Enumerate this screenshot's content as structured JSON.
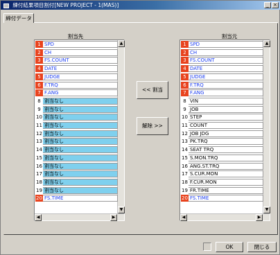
{
  "window": {
    "title": "練付結果項目割付[NEW PROJECT - 1(MAS)]",
    "controls": [
      "_",
      "×"
    ]
  },
  "tab": {
    "label": "締付データ"
  },
  "left_list": {
    "header": "割当先",
    "rows": [
      {
        "num": "1",
        "value": "SPD",
        "style": "blue",
        "num_style": "red"
      },
      {
        "num": "2",
        "value": "CH",
        "style": "blue",
        "num_style": "red"
      },
      {
        "num": "3",
        "value": "FS.COUNT",
        "style": "blue",
        "num_style": "red"
      },
      {
        "num": "4",
        "value": "DATE",
        "style": "blue",
        "num_style": "red"
      },
      {
        "num": "5",
        "value": "JUDGE",
        "style": "blue",
        "num_style": "red"
      },
      {
        "num": "6",
        "value": "F.TRQ",
        "style": "blue",
        "num_style": "red"
      },
      {
        "num": "7",
        "value": "F.ANG",
        "style": "blue",
        "num_style": "red"
      },
      {
        "num": "8",
        "value": "割当なし",
        "style": "cyan",
        "num_style": "plain"
      },
      {
        "num": "9",
        "value": "割当なし",
        "style": "cyan",
        "num_style": "plain"
      },
      {
        "num": "10",
        "value": "割当なし",
        "style": "cyan",
        "num_style": "plain"
      },
      {
        "num": "11",
        "value": "割当なし",
        "style": "cyan",
        "num_style": "plain"
      },
      {
        "num": "12",
        "value": "割当なし",
        "style": "cyan",
        "num_style": "plain"
      },
      {
        "num": "13",
        "value": "割当なし",
        "style": "cyan",
        "num_style": "plain"
      },
      {
        "num": "14",
        "value": "割当なし",
        "style": "cyan",
        "num_style": "plain"
      },
      {
        "num": "15",
        "value": "割当なし",
        "style": "cyan",
        "num_style": "plain"
      },
      {
        "num": "16",
        "value": "割当なし",
        "style": "cyan",
        "num_style": "plain"
      },
      {
        "num": "17",
        "value": "割当なし",
        "style": "cyan",
        "num_style": "plain"
      },
      {
        "num": "18",
        "value": "割当なし",
        "style": "cyan",
        "num_style": "plain"
      },
      {
        "num": "19",
        "value": "割当なし",
        "style": "cyan",
        "num_style": "plain"
      },
      {
        "num": "20",
        "value": "FS.TIME",
        "style": "blue",
        "num_style": "red"
      }
    ]
  },
  "right_list": {
    "header": "割当元",
    "rows": [
      {
        "num": "1",
        "value": "SPD",
        "style": "blue",
        "num_style": "red"
      },
      {
        "num": "2",
        "value": "CH",
        "style": "blue",
        "num_style": "red"
      },
      {
        "num": "3",
        "value": "FS.COUNT",
        "style": "blue",
        "num_style": "red"
      },
      {
        "num": "4",
        "value": "DATE",
        "style": "blue",
        "num_style": "red"
      },
      {
        "num": "5",
        "value": "JUDGE",
        "style": "blue",
        "num_style": "red"
      },
      {
        "num": "6",
        "value": "F.TRQ",
        "style": "blue",
        "num_style": "red"
      },
      {
        "num": "7",
        "value": "F.ANG",
        "style": "blue",
        "num_style": "red"
      },
      {
        "num": "8",
        "value": "VIN",
        "style": "black",
        "num_style": "plain"
      },
      {
        "num": "9",
        "value": "JOB",
        "style": "black",
        "num_style": "plain"
      },
      {
        "num": "10",
        "value": "STEP",
        "style": "black",
        "num_style": "plain"
      },
      {
        "num": "11",
        "value": "COUNT",
        "style": "black",
        "num_style": "plain"
      },
      {
        "num": "12",
        "value": "JOB JDG",
        "style": "black",
        "num_style": "plain"
      },
      {
        "num": "13",
        "value": "PK.TRQ",
        "style": "black",
        "num_style": "plain"
      },
      {
        "num": "14",
        "value": "SEAT TRQ",
        "style": "black",
        "num_style": "plain"
      },
      {
        "num": "15",
        "value": "S.MON.TRQ",
        "style": "black",
        "num_style": "plain"
      },
      {
        "num": "16",
        "value": "ANG.ST.TRQ",
        "style": "black",
        "num_style": "plain"
      },
      {
        "num": "17",
        "value": "S.CUR.MON",
        "style": "black",
        "num_style": "plain"
      },
      {
        "num": "18",
        "value": "F.CUR.MON",
        "style": "black",
        "num_style": "plain"
      },
      {
        "num": "19",
        "value": "FR.TIME",
        "style": "black",
        "num_style": "plain"
      },
      {
        "num": "20",
        "value": "FS.TIME",
        "style": "blue",
        "num_style": "red"
      }
    ]
  },
  "buttons": {
    "assign": "<< 割当",
    "release": "解除 >>",
    "ok": "OK",
    "close": "閉じる"
  },
  "colors": {
    "title_bar": "#0a246a",
    "number_red": "#e8431e",
    "assigned_blue_text": "#1a3cf0",
    "unassigned_cyan": "#7fd0ee"
  }
}
